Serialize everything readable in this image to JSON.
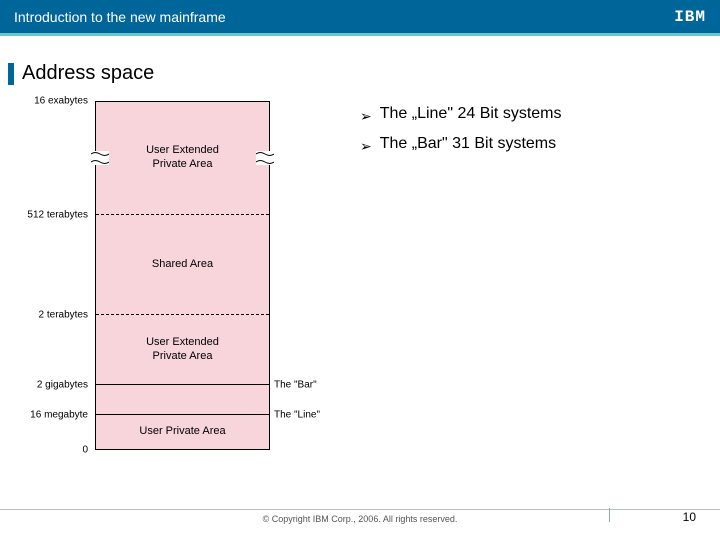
{
  "header": {
    "title": "Introduction to the new mainframe",
    "logo": "IBM"
  },
  "slide": {
    "title": "Address space"
  },
  "diagram": {
    "regions": [
      {
        "label_lines": [
          "User Extended",
          "Private Area"
        ]
      },
      {
        "label_lines": [
          "Shared  Area"
        ]
      },
      {
        "label_lines": [
          "User Extended",
          "Private Area"
        ]
      },
      {
        "label_lines": [
          ""
        ]
      },
      {
        "label_lines": [
          "User Private Area"
        ]
      }
    ],
    "left_labels": {
      "l0": "16 exabytes",
      "l1": "512 terabytes",
      "l2": "2 terabytes",
      "l3": "2 gigabytes",
      "l4": "16 megabyte",
      "l5": "0"
    },
    "right_labels": {
      "bar": "The \"Bar\"",
      "line": "The \"Line\""
    }
  },
  "bullets": [
    "The „Line\" 24 Bit systems",
    "The „Bar\" 31 Bit systems"
  ],
  "footer": {
    "copyright": "© Copyright IBM Corp., 2006. All rights reserved.",
    "page": "10"
  }
}
